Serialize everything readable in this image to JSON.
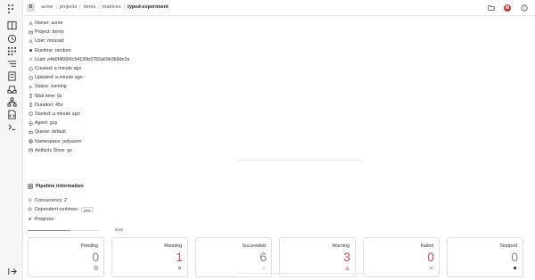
{
  "header": {
    "project_badge": "D",
    "breadcrumbs": [
      "acme",
      "projects",
      "demo",
      "matrices"
    ],
    "current": "typed-experiment",
    "avatar_letter": "M"
  },
  "meta": [
    {
      "icon": "user-icon",
      "text": "Owner: acme"
    },
    {
      "icon": "project-icon",
      "text": "Project: demo"
    },
    {
      "icon": "user-icon",
      "text": "User: mourad"
    },
    {
      "icon": "runtime-icon",
      "text": "Runtime: random"
    },
    {
      "icon": "uuid-icon",
      "text": "Uuid: e4b0f45666c54139b3782a60b3b8de2a"
    },
    {
      "icon": "clock-icon",
      "text": "Created: a minute ago"
    },
    {
      "icon": "clock-icon",
      "text": "Updated: a minute ago"
    },
    {
      "icon": "play-icon",
      "text": "Status: running"
    },
    {
      "icon": "hourglass-icon",
      "text": "Wait time: 0s"
    },
    {
      "icon": "hourglass-icon",
      "text": "Duration: 45s"
    },
    {
      "icon": "clock-icon",
      "text": "Started: a minute ago"
    },
    {
      "icon": "agent-icon",
      "text": "Agent: gcp"
    },
    {
      "icon": "queue-icon",
      "text": "Queue: default"
    },
    {
      "icon": "namespace-icon",
      "text": "Namespace: polyaxon"
    },
    {
      "icon": "store-icon",
      "text": "Artifacts Store: gs"
    }
  ],
  "pipeline": {
    "title": "Pipeline information",
    "concurrency": "Concurrency: 2",
    "dependent_runtimes_label": "Dependent runtimes:",
    "dependent_runtime_chip": "jobs",
    "progress_label": "Progress:",
    "progress_text": "6/10",
    "progress_fraction": 0.6
  },
  "status_cards": [
    {
      "label": "Pending",
      "value": "0",
      "icon": "clock-icon",
      "color": "#888888"
    },
    {
      "label": "Running",
      "value": "1",
      "icon": "play-icon",
      "color": "#b5535b"
    },
    {
      "label": "Succeeded",
      "value": "6",
      "icon": "check-icon",
      "color": "#888888"
    },
    {
      "label": "Warning",
      "value": "3",
      "icon": "warning-icon",
      "color": "#b5535b"
    },
    {
      "label": "Failed",
      "value": "0",
      "icon": "close-icon",
      "color": "#b5535b"
    },
    {
      "label": "Stopped",
      "value": "0",
      "icon": "stop-icon",
      "color": "#888888"
    }
  ]
}
